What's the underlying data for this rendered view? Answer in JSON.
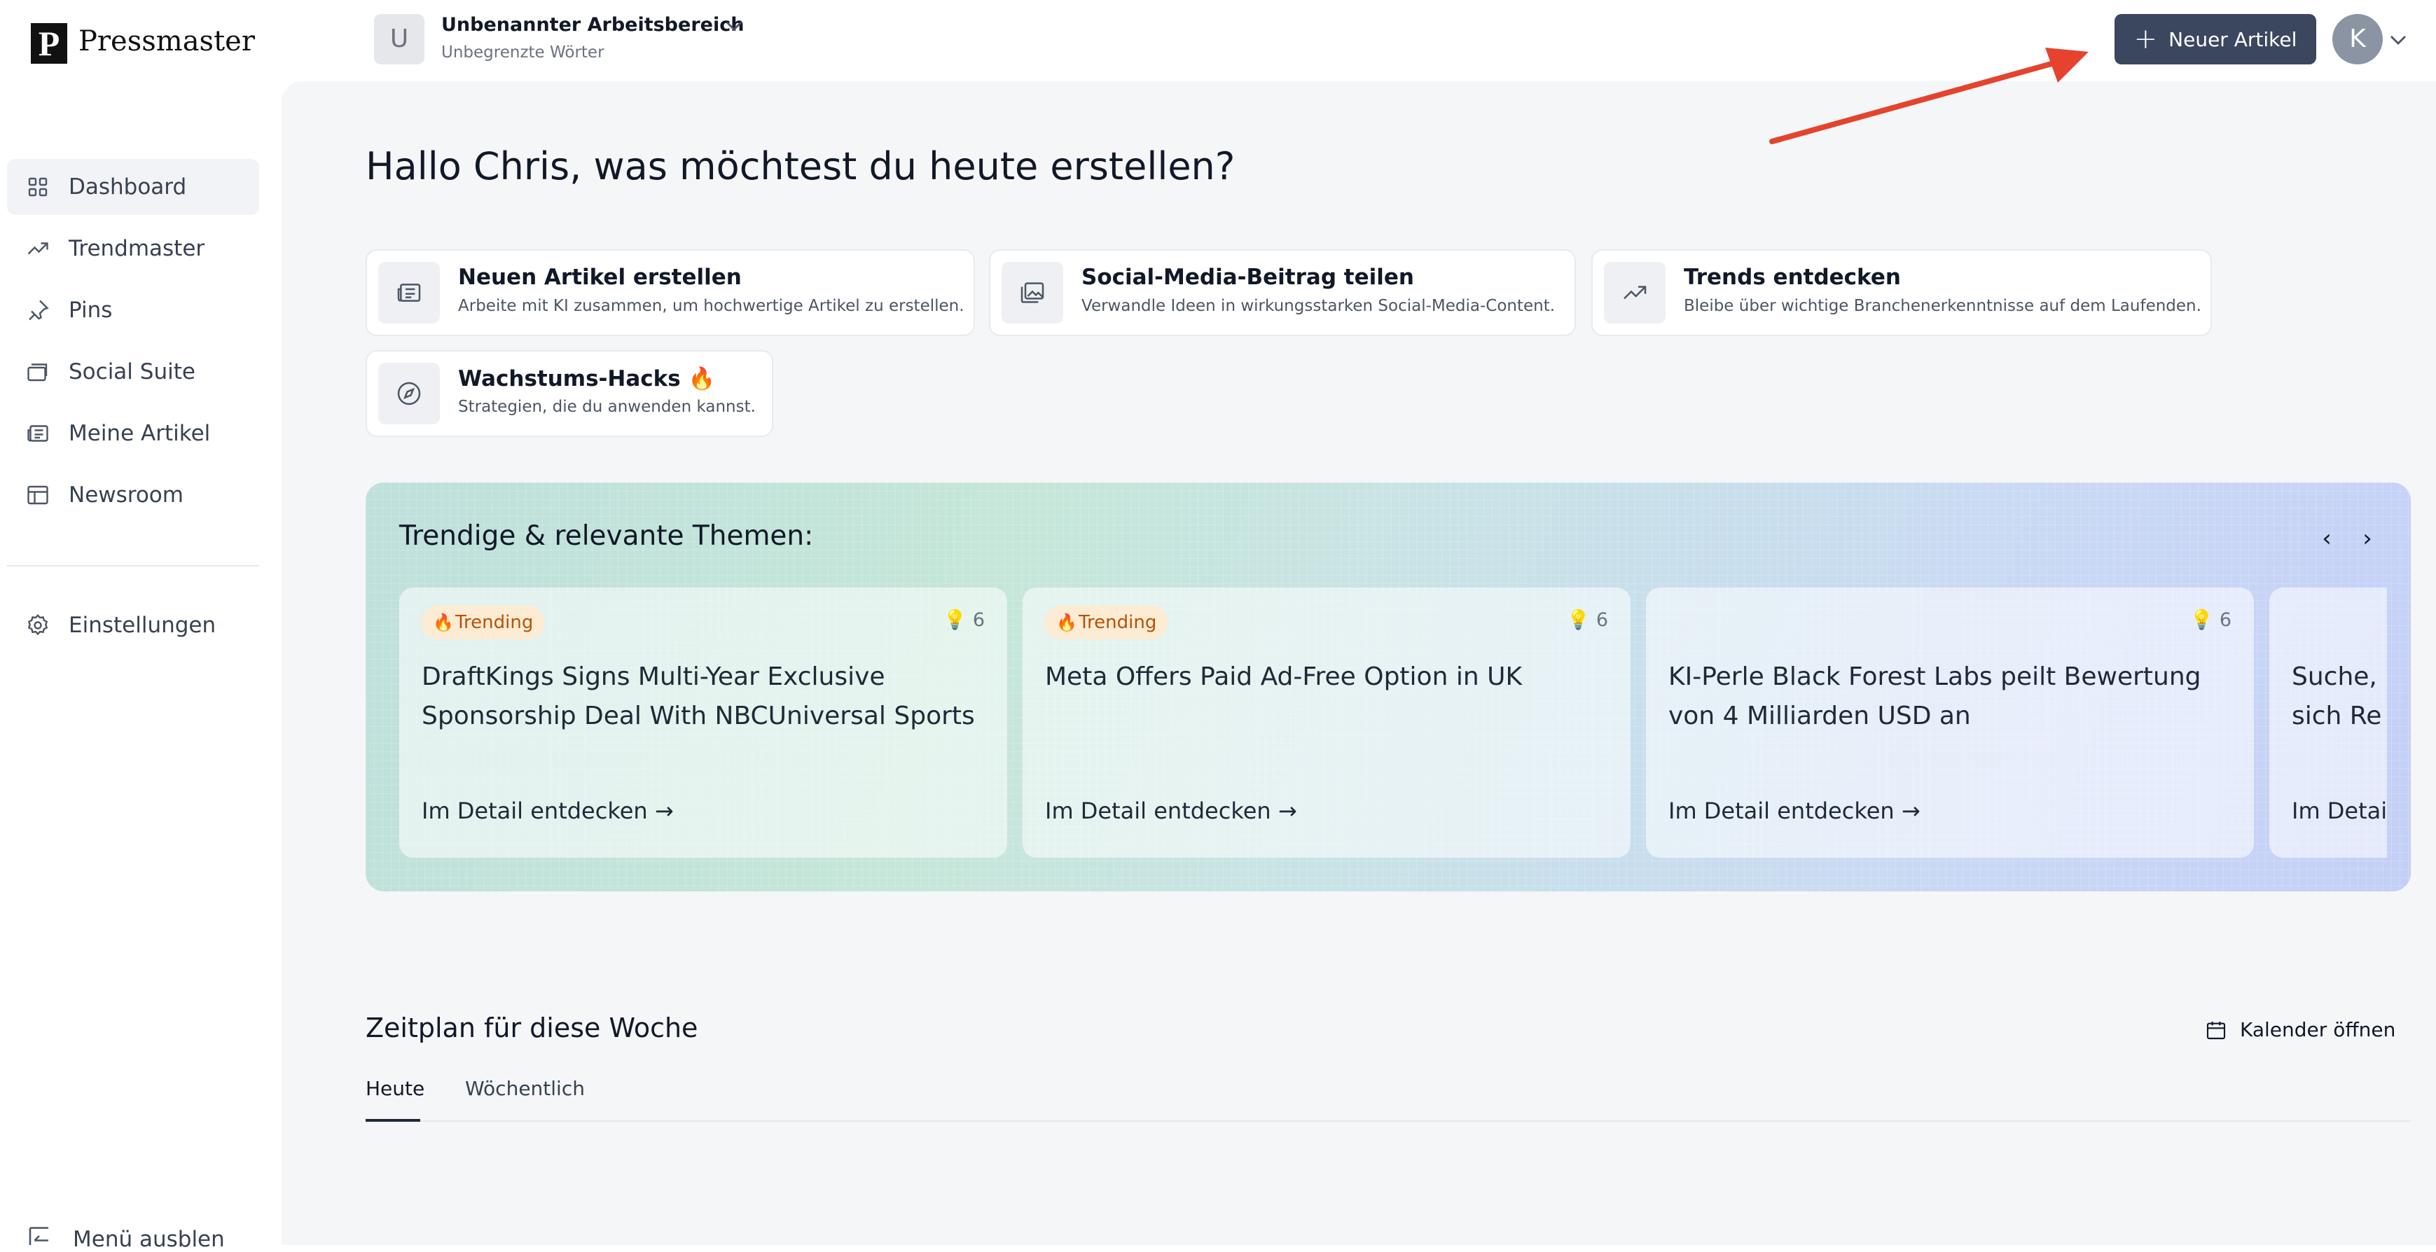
{
  "brand": {
    "logo_letter": "P",
    "name": "Pressmaster"
  },
  "workspace": {
    "initial": "U",
    "name": "Unbenannter Arbeitsbereich",
    "subtitle": "Unbegrenzte Wörter"
  },
  "header": {
    "new_button_label": "Neuer Artikel",
    "avatar_initial": "K"
  },
  "sidebar": {
    "items": [
      {
        "label": "Dashboard",
        "icon": "grid-icon",
        "active": true
      },
      {
        "label": "Trendmaster",
        "icon": "trend-up-icon"
      },
      {
        "label": "Pins",
        "icon": "pin-icon"
      },
      {
        "label": "Social Suite",
        "icon": "cards-icon"
      },
      {
        "label": "Meine Artikel",
        "icon": "newspaper-icon"
      },
      {
        "label": "Newsroom",
        "icon": "layout-icon"
      }
    ],
    "settings_label": "Einstellungen",
    "hide_menu_label": "Menü ausblen"
  },
  "greeting": "Hallo Chris, was möchtest du heute erstellen?",
  "actions": [
    {
      "title": "Neuen Artikel erstellen",
      "desc": "Arbeite mit KI zusammen, um hochwertige Artikel zu erstellen.",
      "icon": "newspaper-icon"
    },
    {
      "title": "Social-Media-Beitrag teilen",
      "desc": "Verwandle Ideen in wirkungsstarken Social-Media-Content.",
      "icon": "images-icon"
    },
    {
      "title": "Trends entdecken",
      "desc": "Bleibe über wichtige Branchenerkenntnisse auf dem Laufenden.",
      "icon": "trend-up-icon"
    },
    {
      "title": "Wachstums-Hacks 🔥",
      "desc": "Strategien, die du anwenden kannst.",
      "icon": "compass-icon"
    }
  ],
  "trending": {
    "title": "Trendige & relevante Themen:",
    "cards": [
      {
        "badge": "Trending",
        "count": "6",
        "headline": "DraftKings Signs Multi-Year Exclusive Sponsorship Deal With NBCUniversal Sports",
        "cta": "Im Detail entdecken"
      },
      {
        "badge": "Trending",
        "count": "6",
        "headline": "Meta Offers Paid Ad-Free Option in UK",
        "cta": "Im Detail entdecken"
      },
      {
        "badge": "",
        "count": "6",
        "headline": "KI-Perle Black Forest Labs peilt Bewertung von 4 Milliarden USD an",
        "cta": "Im Detail entdecken"
      },
      {
        "badge": "",
        "count": "",
        "headline": "Suche, sich Re",
        "cta": "Im Detai"
      }
    ]
  },
  "schedule": {
    "title": "Zeitplan für diese Woche",
    "calendar_label": "Kalender öffnen",
    "tabs": [
      {
        "label": "Heute",
        "active": true
      },
      {
        "label": "Wöchentlich"
      }
    ]
  },
  "colors": {
    "primary_button": "#3b475e",
    "arrow": "#e5432e",
    "badge_bg": "#fdebd3",
    "badge_text": "#b45309"
  }
}
